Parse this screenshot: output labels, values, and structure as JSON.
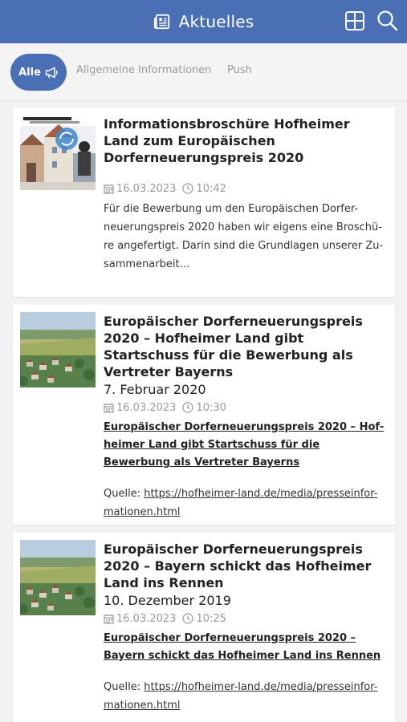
{
  "header": {
    "title": "Aktuelles"
  },
  "filters": {
    "active": "Alle",
    "tabs": [
      "Allgemeine Informationen",
      "Push"
    ]
  },
  "articles": [
    {
      "title": "Informationsbroschüre Hofheimer Land zum Europäischen Dorferneuerungspreis 2020",
      "date": "16.03.2023",
      "time": "10:42",
      "excerpt": "Für die Bewerbung um den Europäischen Dorfer-neuerungspreis 2020 haben wir eigens eine Broschü-re angefertigt. Darin sind die Grundlagen unserer Zu-sammenarbeit…"
    },
    {
      "title": "Europäischer Dorferneuerungspreis 2020 – Hofheimer Land gibt Startschuss für die Bewerbung als Vertreter Bayerns",
      "subtitle": "7. Februar 2020",
      "date": "16.03.2023",
      "time": "10:30",
      "link_title": "Europäischer Dorferneuerungspreis 2020 – Hof-heimer Land gibt Startschuss für die Bewerbung als Vertreter Bayerns",
      "source_label": "Quelle:",
      "source_url": "https://hofheimer-land.de/media/presseinfor-mationen.html"
    },
    {
      "title": "Europäischer Dorferneuerungspreis 2020 – Bayern schickt das Hofheimer Land ins Rennen",
      "subtitle": "10. Dezember 2019",
      "date": "16.03.2023",
      "time": "10:25",
      "link_title": "Europäischer Dorferneuerungspreis 2020 – Bayern schickt das Hofheimer Land ins Rennen",
      "source_label": "Quelle:",
      "source_url": "https://hofheimer-land.de/media/presseinfor-mationen.html"
    }
  ],
  "colors": {
    "header": "#4a6fb5",
    "background": "#f2f2f2",
    "muted": "#999999"
  },
  "icons": [
    "newspaper-icon",
    "grid-icon",
    "search-icon",
    "megaphone-icon",
    "calendar-icon",
    "clock-icon"
  ]
}
